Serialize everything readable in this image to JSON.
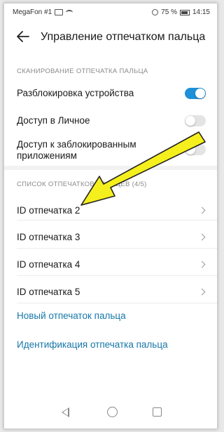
{
  "status_bar": {
    "carrier": "MegaFon #1",
    "battery": "75 %",
    "time": "14:15"
  },
  "header": {
    "title": "Управление отпечатком пальца",
    "back_icon": "arrow-left-icon"
  },
  "scan_section": {
    "header": "СКАНИРОВАНИЕ ОТПЕЧАТКА ПАЛЬЦА",
    "items": [
      {
        "label": "Разблокировка устройства",
        "toggle_on": true
      },
      {
        "label": "Доступ в Личное",
        "toggle_on": false
      },
      {
        "label_line1": "Доступ к заблокированным",
        "label_line2": "приложениям",
        "toggle_on": false
      }
    ]
  },
  "list_section": {
    "header": "СПИСОК ОТПЕЧАТКОВ ПАЛЬЦЕВ (4/5)",
    "items": [
      {
        "label": "ID отпечатка 2"
      },
      {
        "label": "ID отпечатка 3"
      },
      {
        "label": "ID отпечатка 4"
      },
      {
        "label": "ID отпечатка 5"
      }
    ]
  },
  "actions": {
    "new_fingerprint": "Новый отпечаток пальца",
    "identify_fingerprint": "Идентификация отпечатка пальца"
  },
  "colors": {
    "toggle_on": "#1e90d8",
    "link": "#1677a8",
    "annotation_arrow": "#f5ef1e"
  },
  "nav_bar": {
    "icons": [
      "back-triangle-icon",
      "home-circle-icon",
      "recent-square-icon"
    ]
  }
}
